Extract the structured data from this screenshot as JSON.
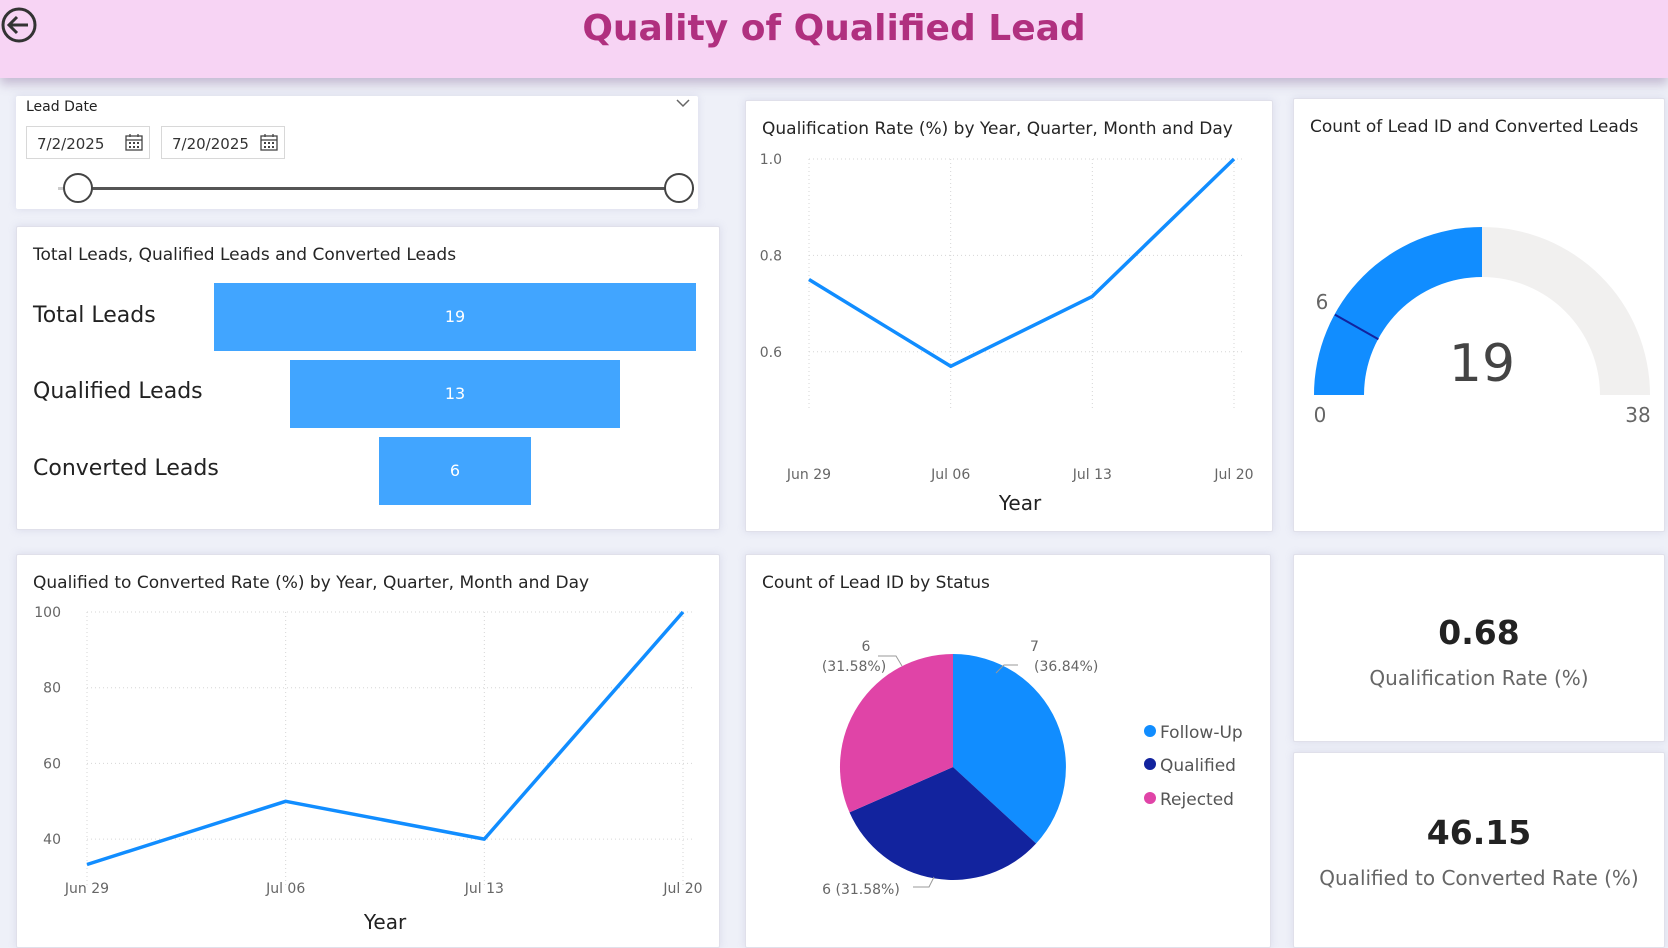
{
  "header": {
    "title": "Quality of Qualified Lead"
  },
  "slicer": {
    "title": "Lead Date",
    "start": "7/2/2025",
    "end": "7/20/2025"
  },
  "funnel": {
    "title": "Total Leads, Qualified Leads and Converted Leads",
    "stages": [
      {
        "label": "Total Leads",
        "value": "19"
      },
      {
        "label": "Qualified Leads",
        "value": "13"
      },
      {
        "label": "Converted Leads",
        "value": "6"
      }
    ]
  },
  "gauge": {
    "title": "Count of Lead ID and Converted Leads",
    "value": "19",
    "min": "0",
    "max": "38",
    "target": "6"
  },
  "pie_legend": [
    {
      "label": "Follow-Up",
      "color": "#118dff"
    },
    {
      "label": "Qualified",
      "color": "#12239e"
    },
    {
      "label": "Rejected",
      "color": "#e044a7"
    }
  ],
  "kpis": {
    "qualification_rate": {
      "value": "0.68",
      "label": "Qualification Rate (%)"
    },
    "qualified_to_converted": {
      "value": "46.15",
      "label": "Qualified to Converted Rate (%)"
    }
  },
  "chart_data": [
    {
      "type": "line",
      "title": "Qualification Rate (%) by Year, Quarter, Month and Day",
      "xlabel": "Year",
      "x_ticks": [
        "Jun 29",
        "Jul 06",
        "Jul 13",
        "Jul 20"
      ],
      "y_ticks": [
        "1.0",
        "0.8",
        "0.6"
      ],
      "ylim": [
        0.5,
        1.0
      ],
      "points": [
        {
          "x": "2025-06-29",
          "y": 0.75
        },
        {
          "x": "2025-07-06",
          "y": 0.57
        },
        {
          "x": "2025-07-13",
          "y": 0.715
        },
        {
          "x": "2025-07-20",
          "y": 1.0
        }
      ],
      "color": "#118dff",
      "grid": true
    },
    {
      "type": "line",
      "title": "Qualified to Converted Rate (%) by Year, Quarter, Month and Day",
      "xlabel": "Year",
      "x_ticks": [
        "Jun 29",
        "Jul 06",
        "Jul 13",
        "Jul 20"
      ],
      "y_ticks": [
        "100",
        "80",
        "60",
        "40"
      ],
      "ylim": [
        30,
        100
      ],
      "points": [
        {
          "x": "2025-06-29",
          "y": 33.3
        },
        {
          "x": "2025-07-06",
          "y": 50
        },
        {
          "x": "2025-07-13",
          "y": 40
        },
        {
          "x": "2025-07-20",
          "y": 100
        }
      ],
      "color": "#118dff",
      "grid": true
    },
    {
      "type": "pie",
      "title": "Count of Lead ID by Status",
      "slices": [
        {
          "label": "Follow-Up",
          "value": 7,
          "percent": "36.84%",
          "color": "#118dff"
        },
        {
          "label": "Qualified",
          "value": 6,
          "percent": "31.58%",
          "color": "#12239e"
        },
        {
          "label": "Rejected",
          "value": 6,
          "percent": "31.58%",
          "color": "#e044a7"
        }
      ]
    }
  ]
}
